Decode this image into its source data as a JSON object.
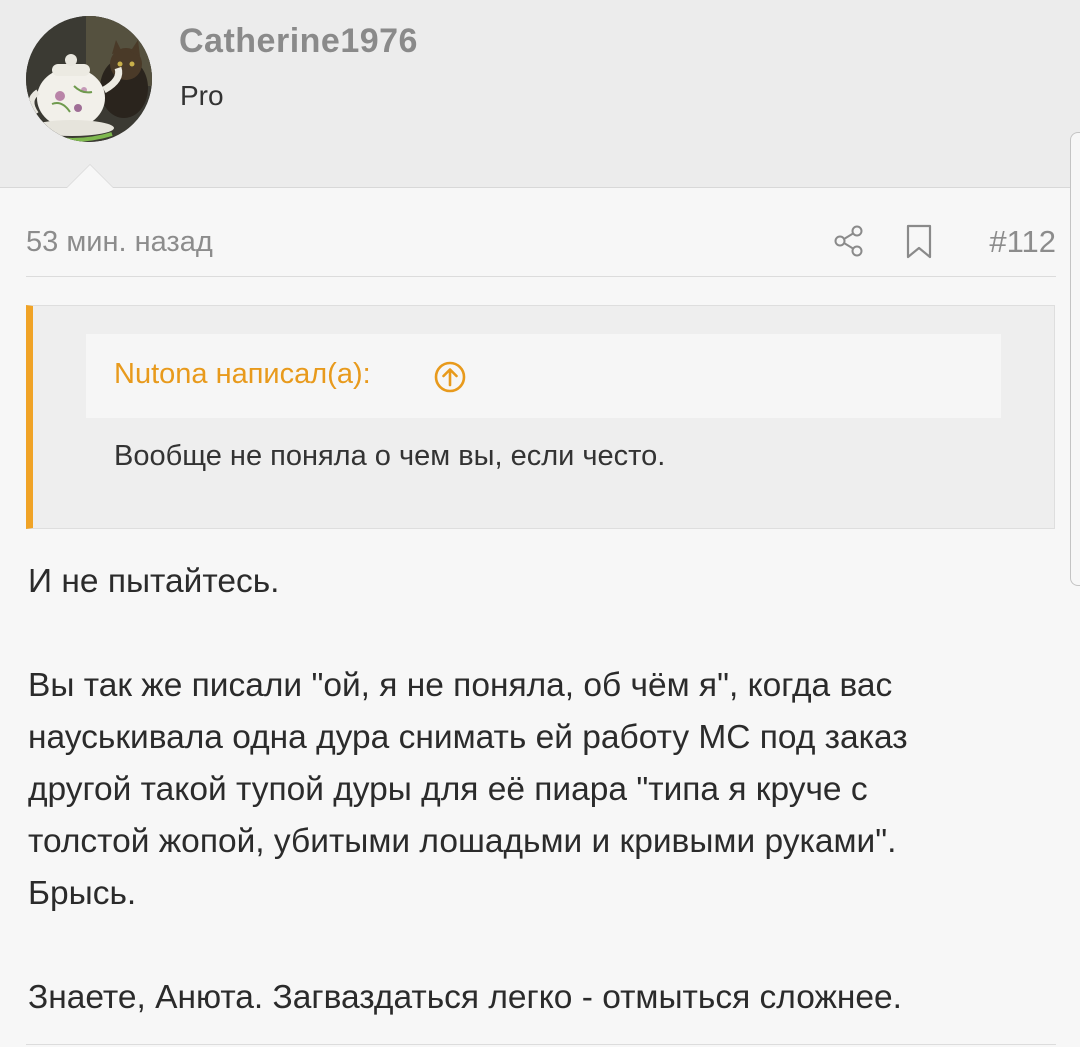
{
  "user": {
    "name": "Catherine1976",
    "title": "Pro"
  },
  "post": {
    "time": "53 мин. назад",
    "number": "#112",
    "icons": [
      "share-icon",
      "bookmark-icon"
    ]
  },
  "quote": {
    "author": "Nutona написал(а):",
    "arrow_icon": "arrow-up-circle-icon",
    "text": "Вообще не поняла о чем вы, если често."
  },
  "message": {
    "lines": [
      "И не пытайтесь.",
      "Вы так же писали \"ой, я не поняла, об чём я\", когда вас",
      "науськивала одна дура снимать ей работу МС под заказ",
      "другой такой тупой дуры для её пиара \"типа я круче с",
      "толстой жопой, убитыми лошадьми и кривыми руками\".",
      "Брысь.",
      "Знаете, Анюта. Загваздаться легко - отмыться сложнее."
    ]
  },
  "colors": {
    "accent": "#f0a326",
    "quote_author": "#e89a1c",
    "header_bg": "#ececec",
    "page_bg": "#f7f7f7"
  }
}
